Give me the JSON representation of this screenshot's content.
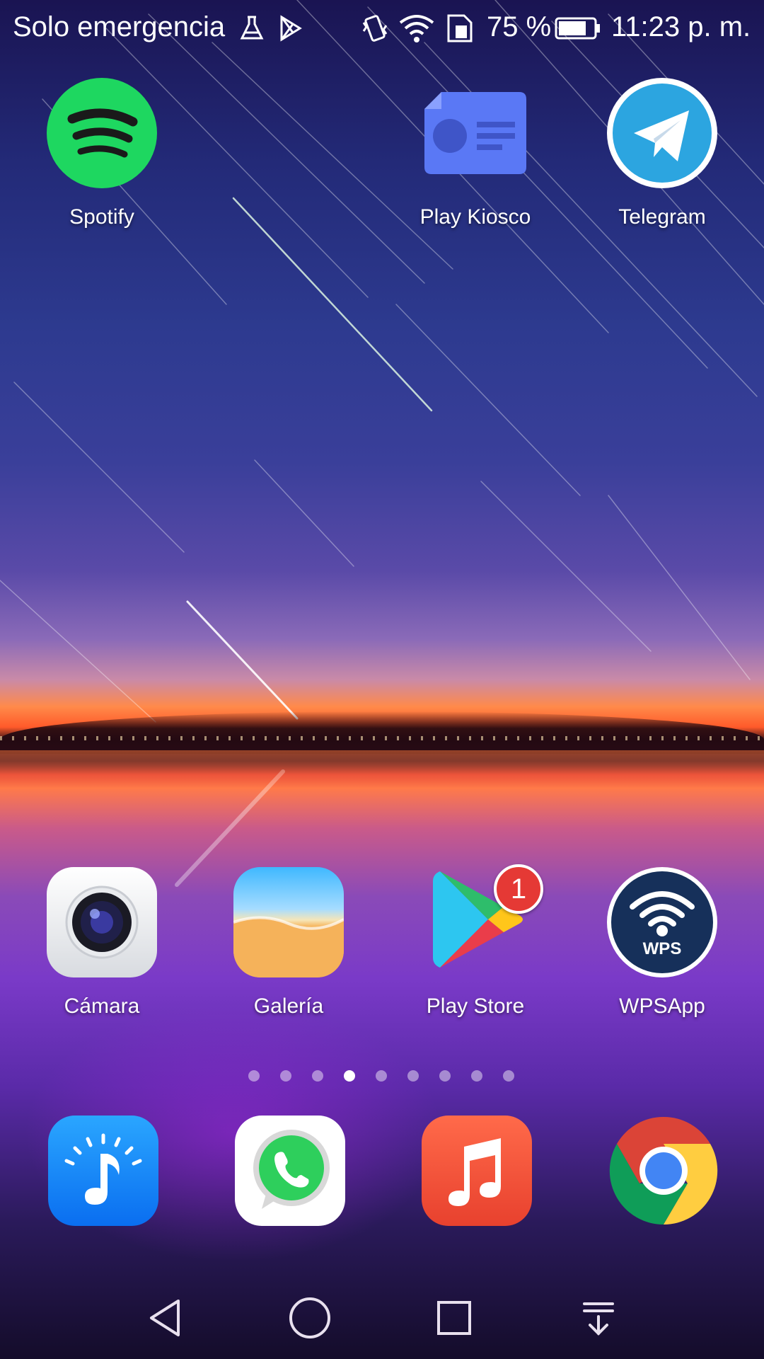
{
  "status_bar": {
    "carrier": "Solo emergencia",
    "battery": "75 %",
    "time": "11:23 p. m."
  },
  "apps": {
    "spotify": "Spotify",
    "play_kiosco": "Play Kiosco",
    "telegram": "Telegram",
    "camara": "Cámara",
    "galeria": "Galería",
    "play_store": "Play Store",
    "play_store_badge": "1",
    "wpsapp": "WPSApp",
    "wps_text": "WPS"
  },
  "pages": {
    "total": 9,
    "current": 4
  },
  "dock": [
    "music-player",
    "whatsapp",
    "music",
    "chrome"
  ],
  "colors": {
    "spotify": "#1ed760",
    "telegram": "#2ca5e0",
    "kiosco": "#4a6af0",
    "badge": "#e53935"
  }
}
